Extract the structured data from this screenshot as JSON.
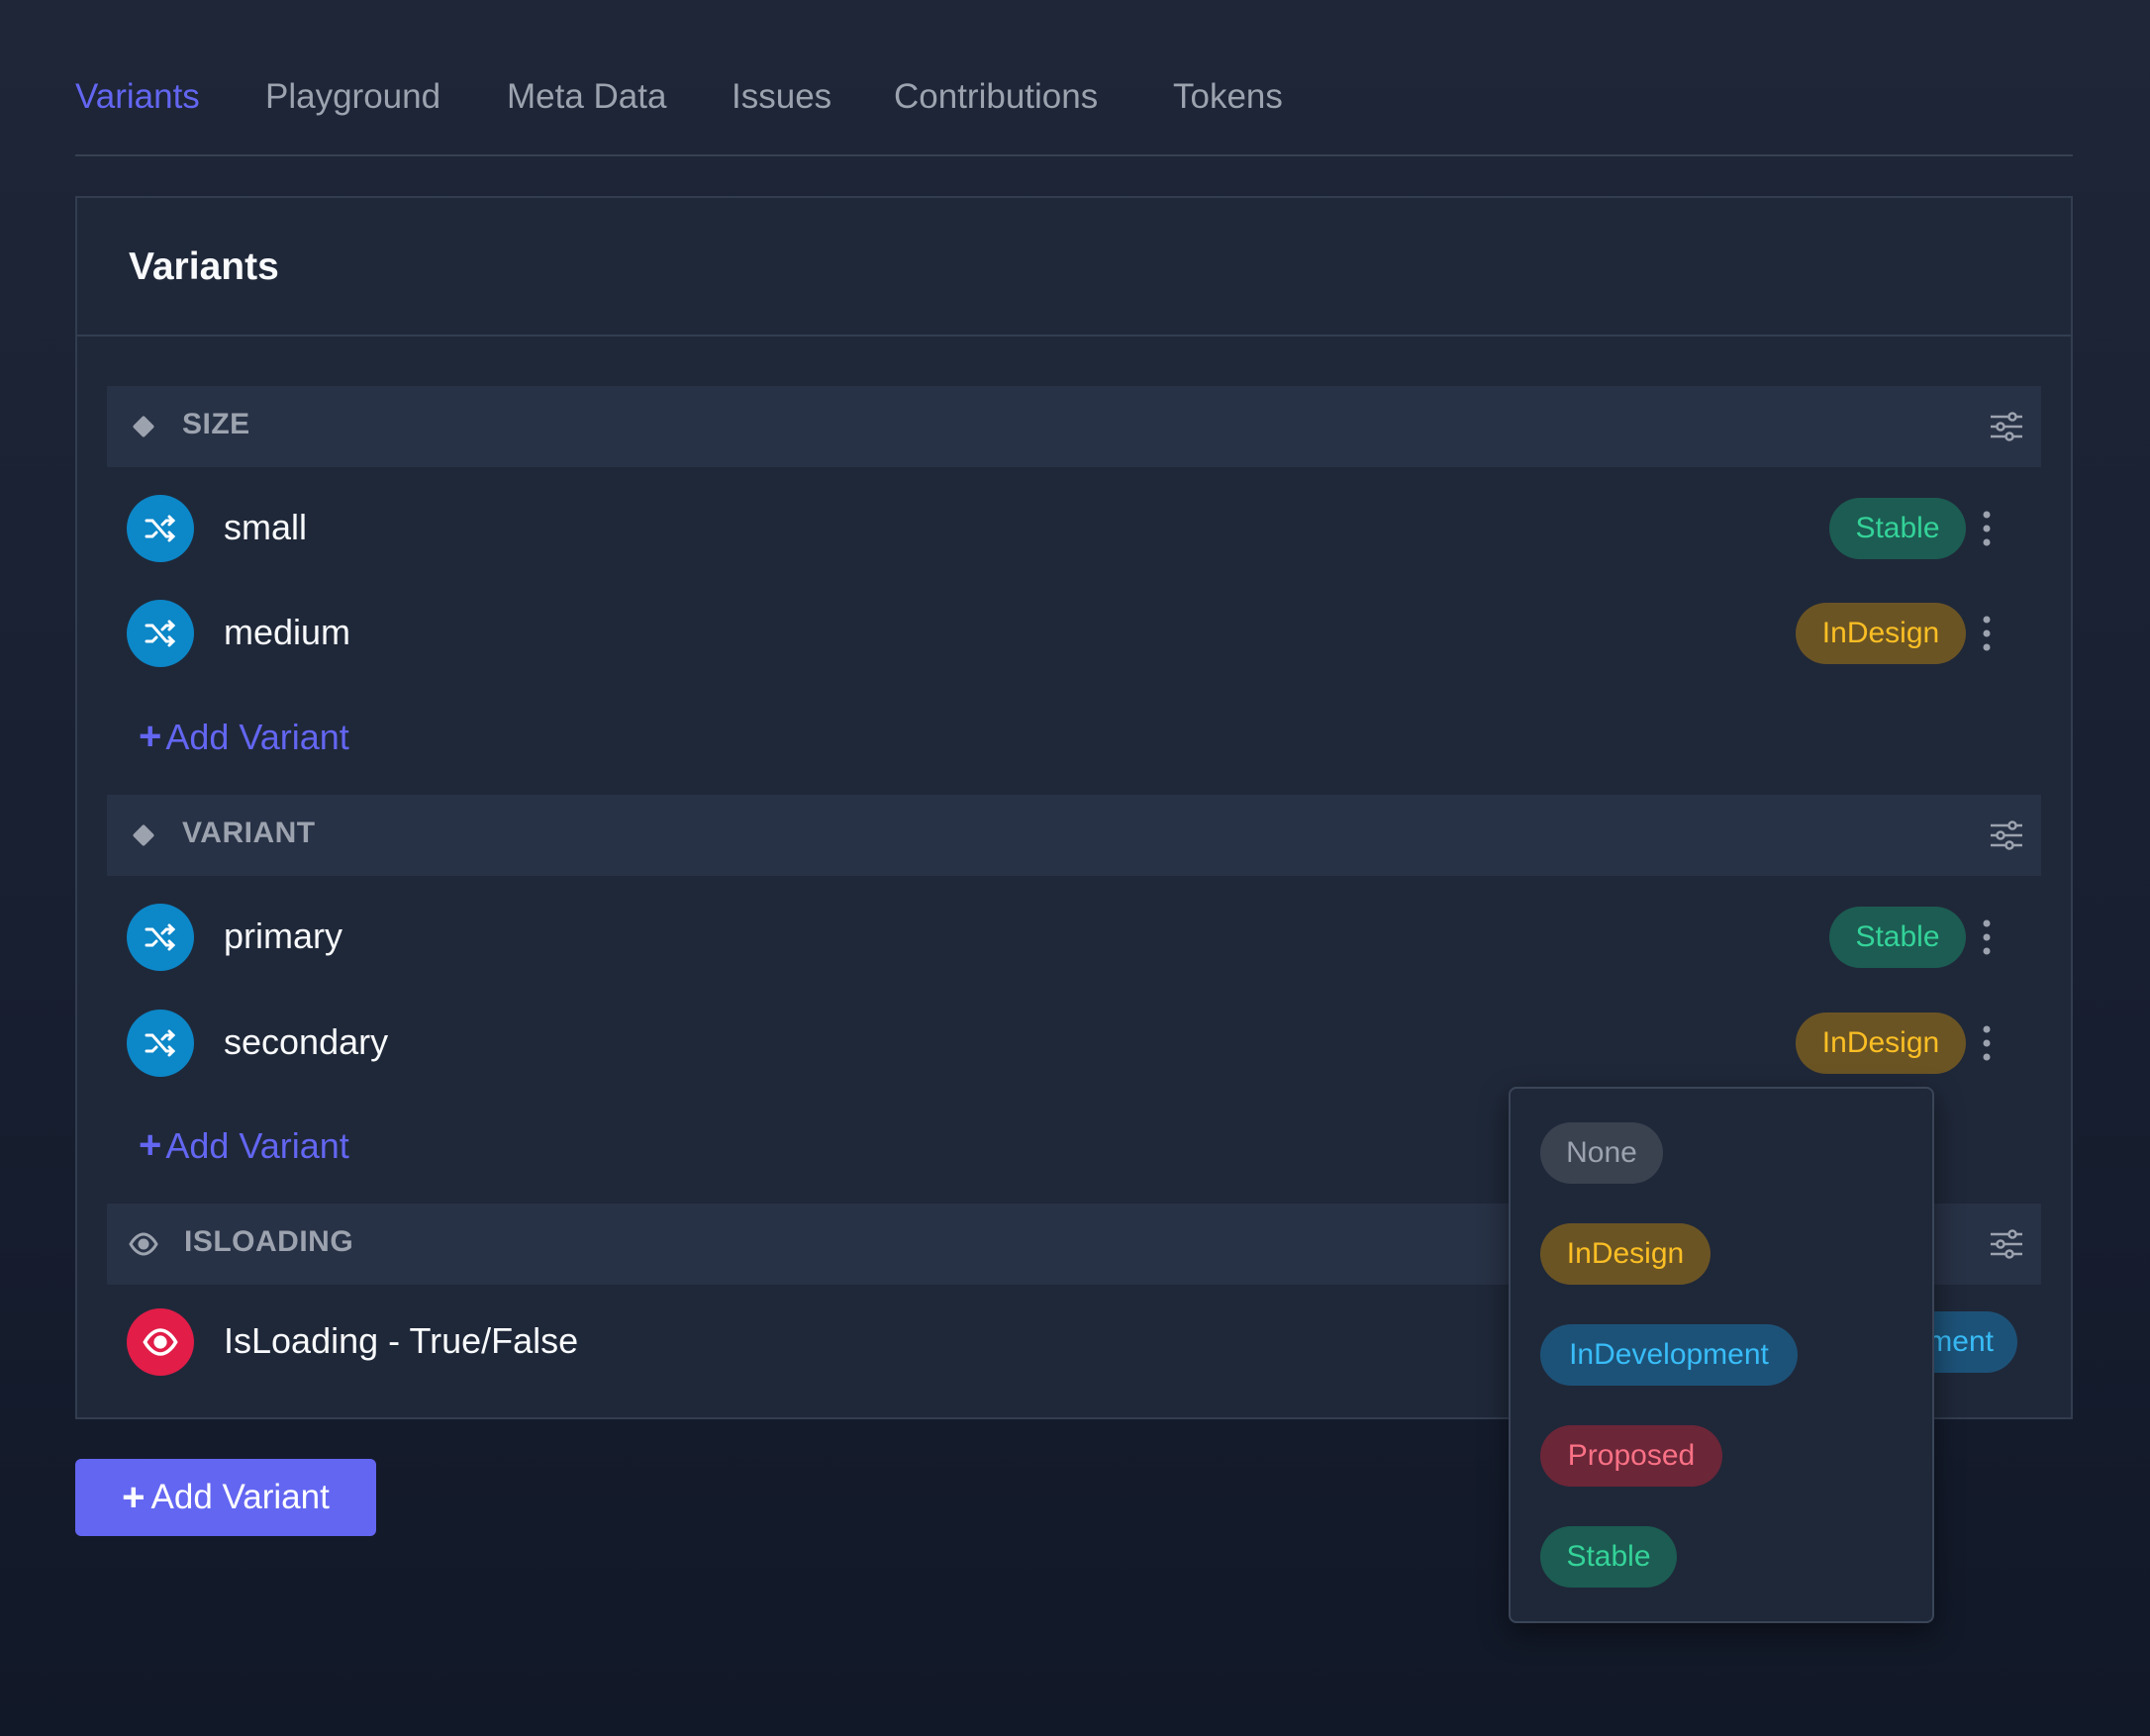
{
  "tabs": [
    {
      "label": "Variants",
      "active": true
    },
    {
      "label": "Playground",
      "active": false
    },
    {
      "label": "Meta Data",
      "active": false
    },
    {
      "label": "Issues",
      "active": false
    },
    {
      "label": "Contributions",
      "active": false
    },
    {
      "label": "Tokens",
      "active": false
    }
  ],
  "panel": {
    "title": "Variants"
  },
  "groups": [
    {
      "label": "SIZE",
      "icon": "diamond-icon",
      "items": [
        {
          "label": "small",
          "icon": "shuffle-icon",
          "status": "Stable"
        },
        {
          "label": "medium",
          "icon": "shuffle-icon",
          "status": "InDesign"
        }
      ],
      "add_label": "Add Variant"
    },
    {
      "label": "VARIANT",
      "icon": "diamond-icon",
      "items": [
        {
          "label": "primary",
          "icon": "shuffle-icon",
          "status": "Stable"
        },
        {
          "label": "secondary",
          "icon": "shuffle-icon",
          "status": "InDesign"
        }
      ],
      "add_label": "Add Variant"
    },
    {
      "label": "ISLOADING",
      "icon": "eye-icon",
      "items": [
        {
          "label": "IsLoading - True/False",
          "icon": "eye-icon",
          "status": "ment"
        }
      ]
    }
  ],
  "add_button": {
    "label": "Add Variant"
  },
  "status_dropdown": {
    "options": [
      "None",
      "InDesign",
      "InDevelopment",
      "Proposed",
      "Stable"
    ]
  },
  "colors": {
    "accent": "#6366f1",
    "stable": "#34d399",
    "indesign": "#fbbf24",
    "indevelopment": "#38bdf8",
    "proposed": "#fb7185",
    "none": "#9ca3af"
  }
}
